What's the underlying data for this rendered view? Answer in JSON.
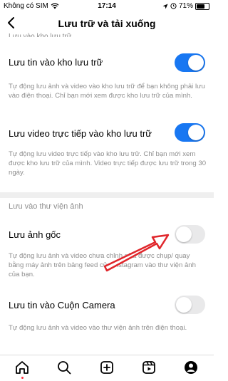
{
  "status_bar": {
    "carrier": "Không có SIM",
    "time": "17:14",
    "battery_percent": "71%",
    "battery_level": 0.71
  },
  "header": {
    "title": "Lưu trữ và tải xuống"
  },
  "archive_section": {
    "title_partial": "Lưu vào kho lưu trữ",
    "items": [
      {
        "label": "Lưu tin vào kho lưu trữ",
        "description": "Tự động lưu ảnh và video vào kho lưu trữ để bạn không phải lưu vào điện thoại. Chỉ bạn mới xem được kho lưu trữ của mình.",
        "enabled": true
      },
      {
        "label": "Lưu video trực tiếp vào kho lưu trữ",
        "description": "Tự động lưu video trực tiếp vào kho lưu trữ. Chỉ bạn mới xem được kho lưu trữ của mình. Video trực tiếp được lưu trữ trong 30 ngày.",
        "enabled": true
      }
    ]
  },
  "gallery_section": {
    "title": "Lưu vào thư viện ảnh",
    "items": [
      {
        "label": "Lưu ảnh gốc",
        "description": "Tự động lưu ảnh và video chưa chỉnh sửa được chụp/ quay bằng máy ảnh trên bảng feed của Instagram vào thư viện ảnh của bạn.",
        "enabled": false
      },
      {
        "label": "Lưu tin vào Cuộn Camera",
        "description": "Tự động lưu ảnh và video vào thư viện ảnh trên điện thoại.",
        "enabled": false
      }
    ]
  },
  "colors": {
    "toggle_on": "#1877f2",
    "toggle_off": "#e9e9ea",
    "arrow": "#e0262b",
    "notification_dot": "#ff3040"
  },
  "tabbar": {
    "icons": [
      "home-icon",
      "search-icon",
      "create-icon",
      "reels-icon",
      "profile-icon"
    ]
  }
}
